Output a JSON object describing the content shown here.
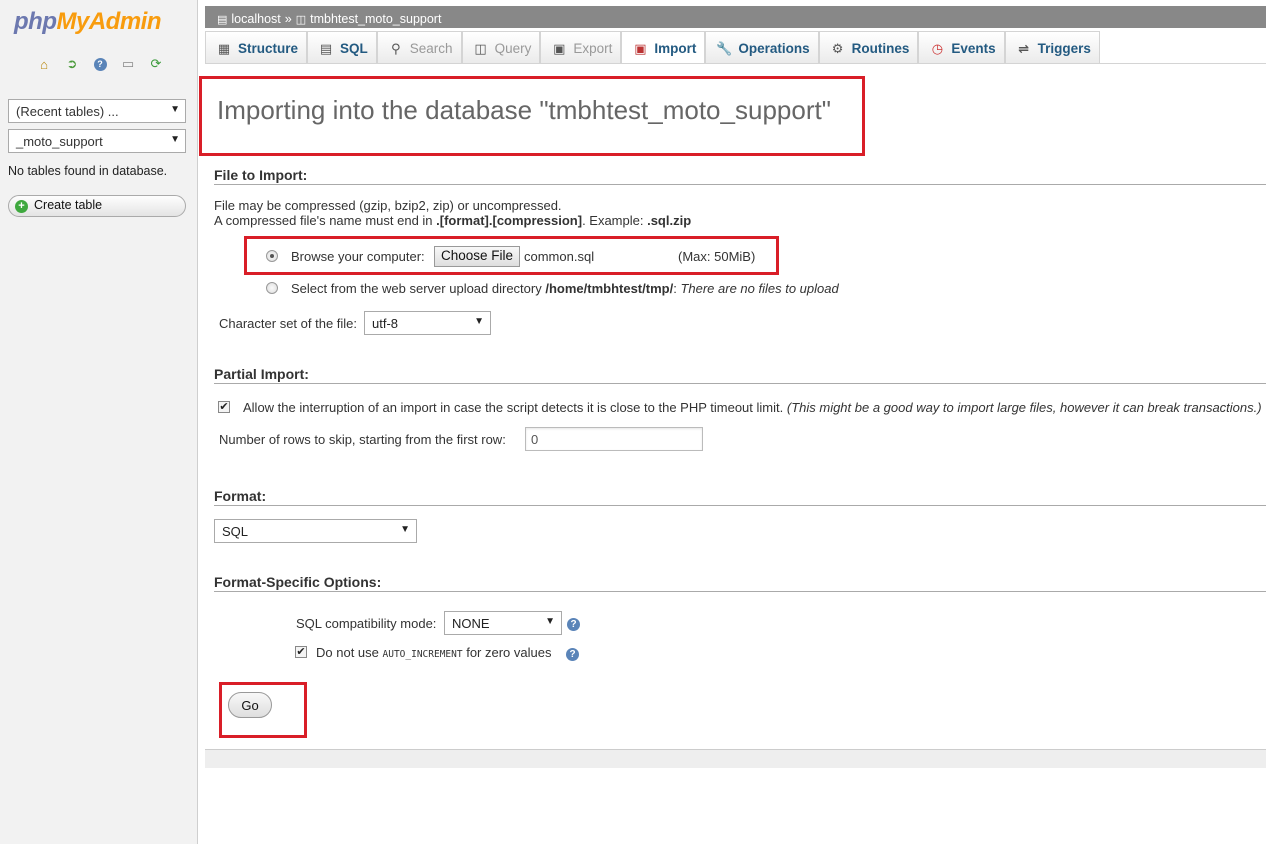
{
  "sidebar": {
    "logo": {
      "php": "php",
      "my": "My",
      "admin": "Admin"
    },
    "nav_icons": [
      "home-icon",
      "logout-icon",
      "help-icon",
      "docs-icon",
      "reload-icon"
    ],
    "recent_tables": "(Recent tables) ...",
    "database_select": "_moto_support",
    "no_tables": "No tables found in database.",
    "create_table": "Create table"
  },
  "breadcrumb": {
    "server": "localhost",
    "separator": "»",
    "database": "tmbhtest_moto_support"
  },
  "tabs": [
    {
      "label": "Structure",
      "icon": "structure-icon"
    },
    {
      "label": "SQL",
      "icon": "sql-icon"
    },
    {
      "label": "Search",
      "icon": "search-icon"
    },
    {
      "label": "Query",
      "icon": "query-icon"
    },
    {
      "label": "Export",
      "icon": "export-icon"
    },
    {
      "label": "Import",
      "icon": "import-icon"
    },
    {
      "label": "Operations",
      "icon": "wrench-icon"
    },
    {
      "label": "Routines",
      "icon": "routines-icon"
    },
    {
      "label": "Events",
      "icon": "clock-icon"
    },
    {
      "label": "Triggers",
      "icon": "triggers-icon"
    }
  ],
  "title": "Importing into the database \"tmbhtest_moto_support\"",
  "file_import": {
    "heading": "File to Import:",
    "desc1": "File may be compressed (gzip, bzip2, zip) or uncompressed.",
    "desc2_prefix": "A compressed file's name must end in ",
    "desc2_format": ".[format].[compression]",
    "desc2_mid": ". Example: ",
    "desc2_example": ".sql.zip",
    "browse_label": "Browse your computer:",
    "choose_file": "Choose File",
    "file_name": "common.sql",
    "max_size": "(Max: 50MiB)",
    "server_prefix": "Select from the web server upload directory ",
    "server_dir": "/home/tmbhtest/tmp/",
    "server_colon": ":",
    "server_note": "There are no files to upload",
    "charset_label": "Character set of the file:",
    "charset_value": "utf-8"
  },
  "partial": {
    "heading": "Partial Import:",
    "allow_text": "Allow the interruption of an import in case the script detects it is close to the PHP timeout limit.",
    "allow_note": "(This might be a good way to import large files, however it can break transactions.)",
    "skip_label": "Number of rows to skip, starting from the first row:",
    "skip_value": "0"
  },
  "format": {
    "heading": "Format:",
    "value": "SQL"
  },
  "options": {
    "heading": "Format-Specific Options:",
    "compat_label": "SQL compatibility mode:",
    "compat_value": "NONE",
    "auto_prefix": "Do not use",
    "auto_code": "AUTO_INCREMENT",
    "auto_suffix": "for zero values"
  },
  "go": "Go",
  "colors": {
    "accent_red": "#d91e28",
    "tab_text": "#235a81"
  }
}
